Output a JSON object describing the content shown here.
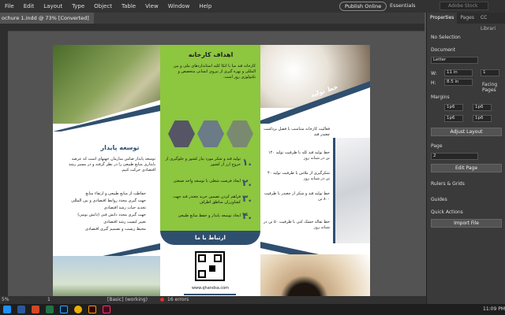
{
  "menu": [
    "File",
    "Edit",
    "Layout",
    "Type",
    "Object",
    "Table",
    "View",
    "Window",
    "Help"
  ],
  "publish_label": "Publish Online",
  "workspace": "Essentials",
  "search_placeholder": "Adobe Stock",
  "doc_tab": "ochure 1.indd @ 73% [Converted]",
  "status": {
    "zoom": "5%",
    "page": "1",
    "style": "[Basic] (working)",
    "errors": "16 errors"
  },
  "clock": "11:09 PM",
  "panel_tabs": [
    "Properties",
    "Pages",
    "CC Librari"
  ],
  "properties": {
    "no_selection": "No Selection",
    "document": "Document",
    "page_size": "Letter",
    "w_label": "W:",
    "w_value": "11 in",
    "h_label": "H:",
    "h_value": "8.5 in",
    "pages": "1",
    "facing": "Facing Pages",
    "margins": "Margins",
    "m_top": "1p6",
    "m_bottom": "1p6",
    "m_left": "1p6",
    "m_right": "1p6",
    "adjust_layout": "Adjust Layout",
    "page": "Page",
    "page_value": "2",
    "edit_page": "Edit Page",
    "rulers": "Rulers & Grids",
    "guides": "Guides",
    "quick_actions": "Quick Actions",
    "import_file": "Import File"
  },
  "brochure": {
    "p1_title": "توسعه پایدار",
    "p1_body": "توسعه پایدار ضامن سازمان جهتهای است که عرصه پایداری منابع طبیعی را در نظر گرفته و در مسیر رشد اقتصادی حرکت کنیم.",
    "p1_bullets": [
      "حفاظت از منابع طبیعی و ارتقاء منابع",
      "جهت گیری مجدد روابط اقتصادی و بین المللی",
      "تجدید حیات رشد اقتصادی",
      "جهت گیری مجدد دانش فنی (دانش بومی)",
      "تغییر کیفیت رشد اقتصادی",
      "محیط زیست و تصمیم گیری اقتصادی"
    ],
    "p2_title": "اهداف کارخانه",
    "p2_body": "کارخانه قند سا با اتکا کلیه استانداردهای ملی و بین المللی و بهره گیری از نیروی انسانی متخصص و تکنولوژی روز است.",
    "p2_goals": [
      {
        "n": "۱.",
        "t": "تولید قند و شکر مورد نیاز کشور و جلوگیری از خروج ارز از کشور"
      },
      {
        "n": "۲.",
        "t": "ایجاد فرصت شغلی با توسعه واحد صنعتی"
      },
      {
        "n": "۳.",
        "t": "فراهم کردن تضمین خرید چغندر قند جهت کشاورزان مناطق اطراف"
      },
      {
        "n": "۴.",
        "t": "ایجاد توسعه پایدار و حفظ منابع طبیعی"
      }
    ],
    "p2_contact": "ارتباط با ما",
    "p2_url": "www.qhandsa.com",
    "p3_title": "خط تولید",
    "p3_bullets": [
      "فعالیت کارخانه متناسب با فصل برداشت چغندر قند",
      "خط تولید قند کله با ظرفیت تولید ۱۲۰ تن در شبانه روز",
      "شکرگیری از ملاس با ظرفیت تولید ۴۰ تن در شبانه روز",
      "خط تولید قند و شکر از چغندر با ظرفیت ۸۰۰ تن",
      "خط تفاله خشک کنی با ظرفیت ۵۰ تن در شبانه روز"
    ]
  }
}
